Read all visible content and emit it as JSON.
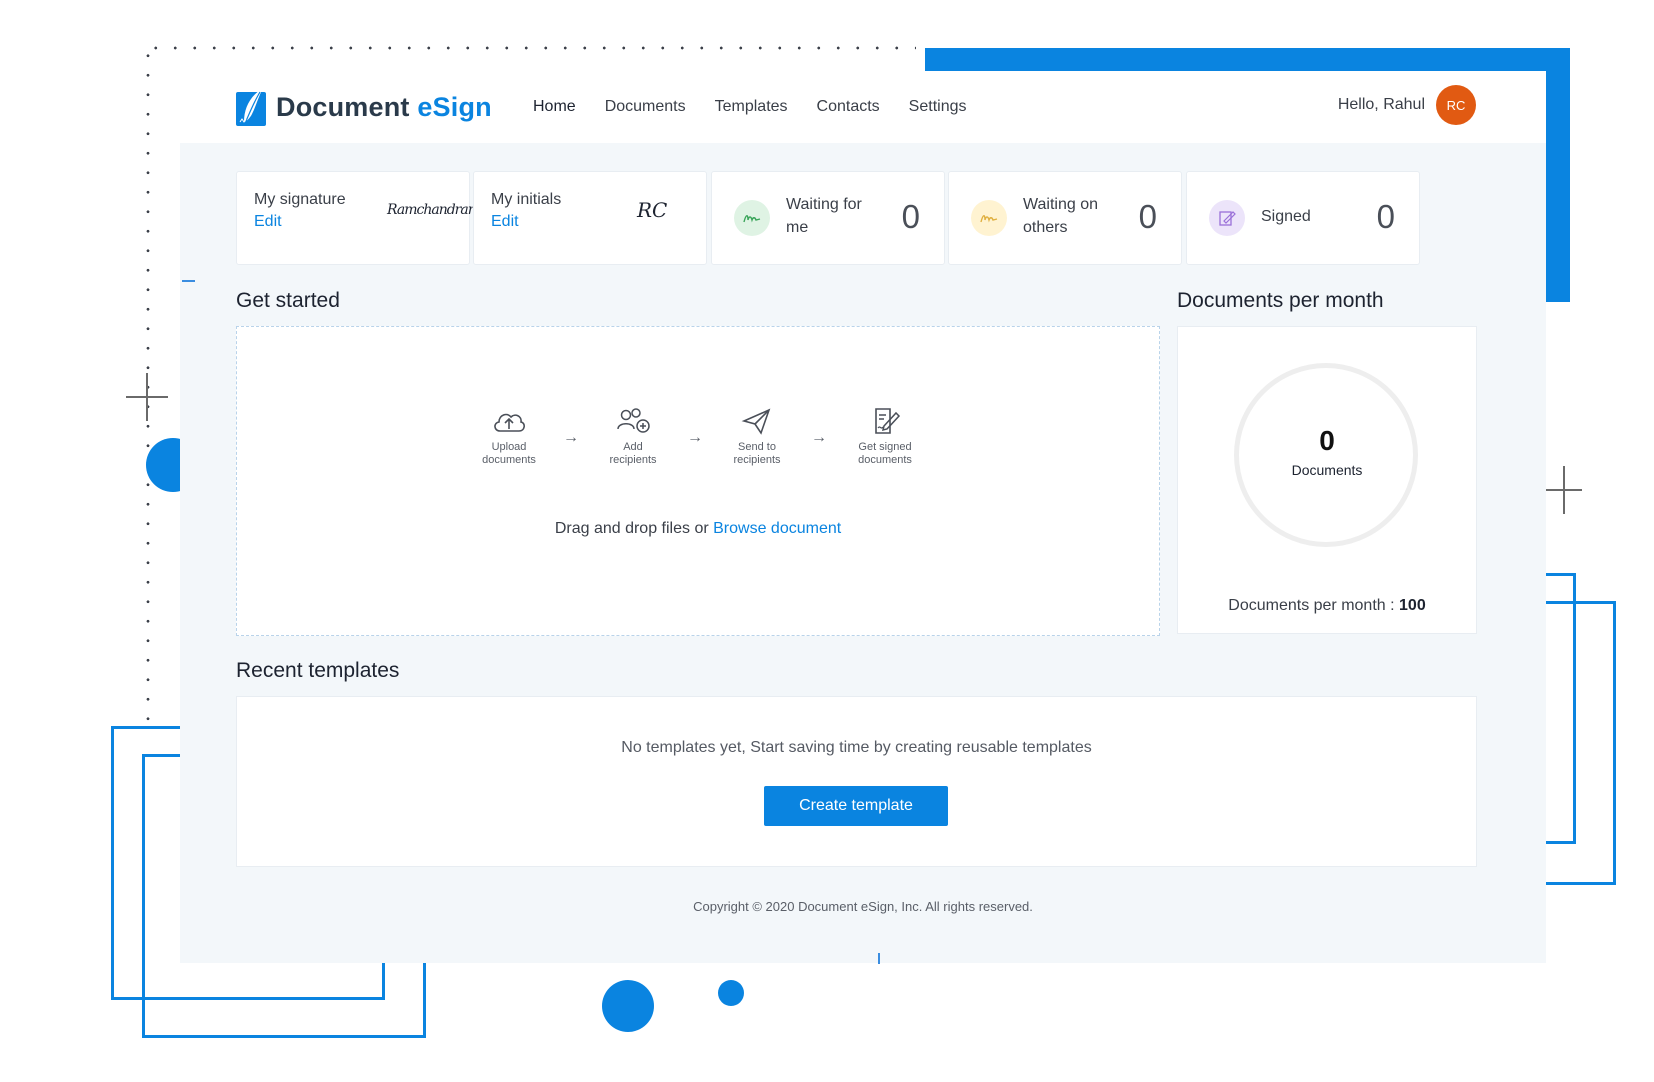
{
  "app": {
    "logo_word_1": "Document",
    "logo_word_2": "eSign",
    "colors": {
      "accent": "#0a84e0",
      "avatar": "#e15a12",
      "background": "#f3f7fa"
    }
  },
  "nav": {
    "items": [
      {
        "label": "Home",
        "active": true
      },
      {
        "label": "Documents"
      },
      {
        "label": "Templates"
      },
      {
        "label": "Contacts"
      },
      {
        "label": "Settings"
      }
    ]
  },
  "user": {
    "greeting": "Hello, Rahul",
    "initials": "RC"
  },
  "stats": {
    "signature": {
      "label": "My signature",
      "edit": "Edit",
      "value": "Ramchandran"
    },
    "initials": {
      "label": "My initials",
      "edit": "Edit",
      "value": "RC"
    },
    "waiting_for_me": {
      "label_1": "Waiting for",
      "label_2": "me",
      "count": "0",
      "icon": "signature-icon"
    },
    "waiting_on_others": {
      "label_1": "Waiting on",
      "label_2": "others",
      "count": "0",
      "icon": "signature-icon"
    },
    "signed": {
      "label": "Signed",
      "count": "0",
      "icon": "signed-document-icon"
    }
  },
  "get_started": {
    "title": "Get started",
    "steps": [
      {
        "line_1": "Upload",
        "line_2": "documents",
        "icon": "cloud-upload-icon"
      },
      {
        "line_1": "Add",
        "line_2": "recipients",
        "icon": "add-users-icon"
      },
      {
        "line_1": "Send to",
        "line_2": "recipients",
        "icon": "paper-plane-icon"
      },
      {
        "line_1": "Get signed",
        "line_2": "documents",
        "icon": "signed-document-icon"
      }
    ],
    "arrow": "→",
    "drop_text": "Drag and drop files or ",
    "browse_link": "Browse document"
  },
  "monthly": {
    "title": "Documents per month",
    "count": "0",
    "count_label": "Documents",
    "footer_label": "Documents per month : ",
    "footer_value": "100"
  },
  "recent_templates": {
    "title": "Recent templates",
    "empty_text": "No templates yet, Start saving time by creating reusable templates",
    "button": "Create template"
  },
  "footer": {
    "copyright": "Copyright © 2020 Document eSign, Inc. All rights reserved."
  }
}
